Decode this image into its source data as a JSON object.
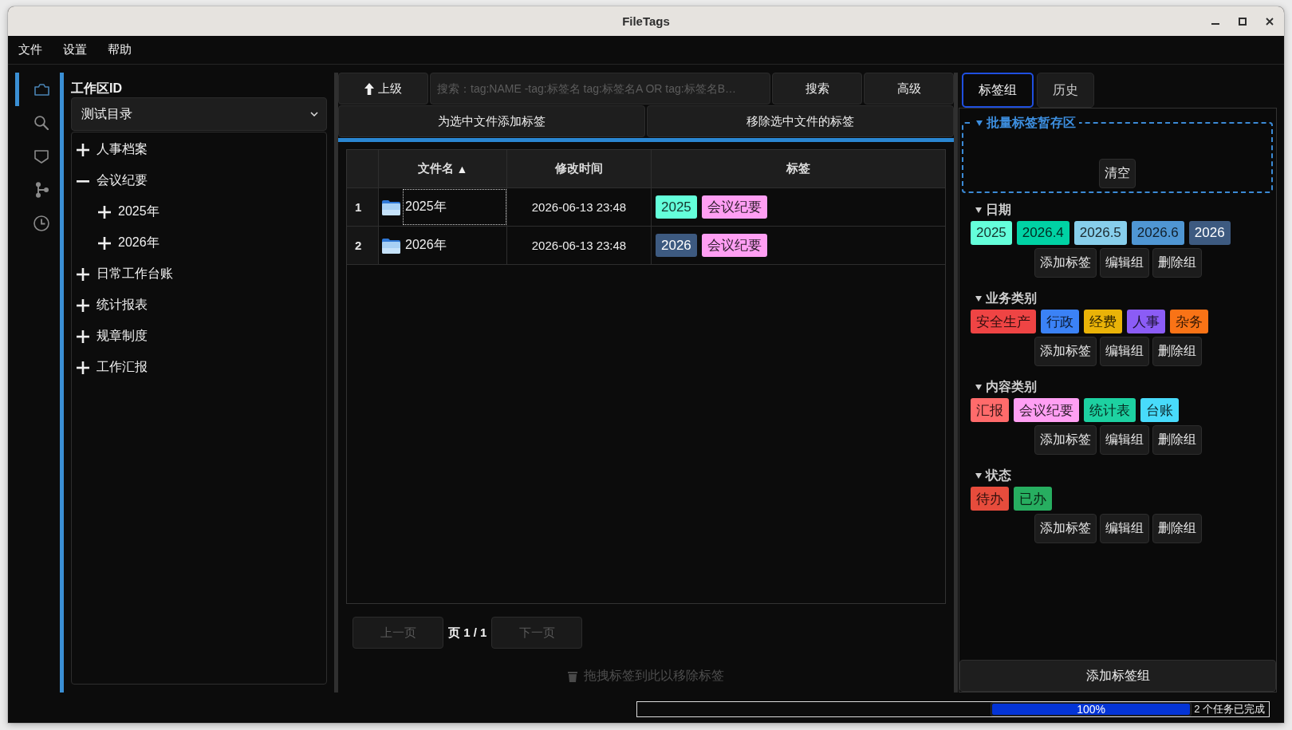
{
  "window": {
    "title": "FileTags"
  },
  "menu": [
    "文件",
    "设置",
    "帮助"
  ],
  "activity_bar": [
    {
      "selected": true
    },
    {
      "selected": false
    },
    {
      "selected": false
    },
    {
      "selected": false
    },
    {
      "selected": false
    }
  ],
  "workspace": {
    "label": "工作区ID",
    "value": "测试目录"
  },
  "tree": [
    {
      "label": "人事档案",
      "expanded": false
    },
    {
      "label": "会议纪要",
      "expanded": true,
      "children": [
        {
          "label": "2025年",
          "expanded": false
        },
        {
          "label": "2026年",
          "expanded": false
        }
      ]
    },
    {
      "label": "日常工作台账",
      "expanded": false
    },
    {
      "label": "统计报表",
      "expanded": false
    },
    {
      "label": "规章制度",
      "expanded": false
    },
    {
      "label": "工作汇报",
      "expanded": false
    }
  ],
  "toolbar": {
    "up_button": "上级",
    "search": {
      "placeholder": "搜索：tag:NAME -tag:标签名 tag:标签名A OR tag:标签名B…"
    },
    "search_button": "搜索",
    "advanced_button": "高级"
  },
  "tag_actions": [
    "为选中文件添加标签",
    "移除选中文件的标签"
  ],
  "table": {
    "columns": [
      {
        "label": "文件名",
        "sort_indicator": "▲"
      },
      {
        "label": "修改时间"
      },
      {
        "label": "标签"
      }
    ],
    "rows": [
      {
        "number": "1",
        "name": "2025年",
        "modified": "2026-06-13 23:48",
        "focused": true,
        "tags": [
          {
            "label": "2025",
            "color": "#64ffda"
          },
          {
            "label": "会议纪要",
            "color": "#ff9ff3"
          }
        ]
      },
      {
        "number": "2",
        "name": "2026年",
        "modified": "2026-06-13 23:48",
        "focused": false,
        "tags": [
          {
            "label": "2026",
            "color": "#3d5a80"
          },
          {
            "label": "会议纪要",
            "color": "#ff9ff3"
          }
        ]
      }
    ]
  },
  "pagination": {
    "previous": {
      "label": "上一页",
      "disabled": true
    },
    "page": "页 1 / 1",
    "next": {
      "label": "下一页",
      "disabled": true
    }
  },
  "drop_hint": "拖拽标签到此以移除标签",
  "right_panel": {
    "tabs": [
      {
        "label": "标签组",
        "selected": true
      },
      {
        "label": "历史",
        "selected": false
      }
    ],
    "staging": {
      "title": "批量标签暂存区",
      "expanded": true,
      "clear_button": "清空"
    },
    "tag_groups": [
      {
        "name": "日期",
        "expanded": true,
        "tags": [
          {
            "label": "2025",
            "color": "#64ffda"
          },
          {
            "label": "2026.4",
            "color": "#00d2a4"
          },
          {
            "label": "2026.5",
            "color": "#87ceeb"
          },
          {
            "label": "2026.6",
            "color": "#4f96d3"
          },
          {
            "label": "2026",
            "color": "#3d5a80"
          }
        ],
        "actions": [
          "添加标签",
          "编辑组",
          "删除组"
        ]
      },
      {
        "name": "业务类别",
        "expanded": true,
        "tags": [
          {
            "label": "安全生产",
            "color": "#ef4444"
          },
          {
            "label": "行政",
            "color": "#3b82f6"
          },
          {
            "label": "经费",
            "color": "#eab308"
          },
          {
            "label": "人事",
            "color": "#8b5cf6"
          },
          {
            "label": "杂务",
            "color": "#f97316"
          }
        ],
        "actions": [
          "添加标签",
          "编辑组",
          "删除组"
        ]
      },
      {
        "name": "内容类别",
        "expanded": true,
        "tags": [
          {
            "label": "汇报",
            "color": "#ff6b6b"
          },
          {
            "label": "会议纪要",
            "color": "#ff9ff3"
          },
          {
            "label": "统计表",
            "color": "#1dd1a1"
          },
          {
            "label": "台账",
            "color": "#48dbfb"
          }
        ],
        "actions": [
          "添加标签",
          "编辑组",
          "删除组"
        ]
      },
      {
        "name": "状态",
        "expanded": true,
        "tags": [
          {
            "label": "待办",
            "color": "#e74c3c"
          },
          {
            "label": "已办",
            "color": "#27ae60"
          }
        ],
        "actions": [
          "添加标签",
          "编辑组",
          "删除组"
        ]
      }
    ],
    "add_group_button": "添加标签组"
  },
  "status_bar": {
    "progress": {
      "level": 1,
      "text": "100%"
    },
    "message": "2 个任务已完成"
  }
}
